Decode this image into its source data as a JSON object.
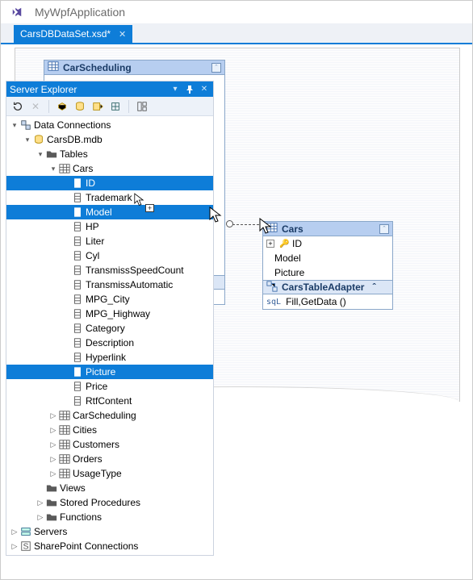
{
  "app": {
    "title": "MyWpfApplication"
  },
  "file_tab": {
    "label": "CarsDBDataSet.xsd*"
  },
  "panel": {
    "title": "Server Explorer",
    "toolbar": {
      "refresh": "↻",
      "stop": "✕"
    }
  },
  "tree": {
    "data_connections": "Data Connections",
    "db": "CarsDB.mdb",
    "tables": "Tables",
    "cars": "Cars",
    "columns": {
      "id": "ID",
      "trademark": "Trademark",
      "model": "Model",
      "hp": "HP",
      "liter": "Liter",
      "cyl": "Cyl",
      "tsc": "TransmissSpeedCount",
      "ta": "TransmissAutomatic",
      "mpgc": "MPG_City",
      "mpgh": "MPG_Highway",
      "category": "Category",
      "desc": "Description",
      "hyper": "Hyperlink",
      "picture": "Picture",
      "price": "Price",
      "rtf": "RtfContent"
    },
    "other_tables": {
      "carscheduling": "CarScheduling",
      "cities": "Cities",
      "customers": "Customers",
      "orders": "Orders",
      "usagetype": "UsageType"
    },
    "views": "Views",
    "sprocs": "Stored Procedures",
    "funcs": "Functions",
    "servers": "Servers",
    "sharepoint": "SharePoint Connections"
  },
  "designer": {
    "carscheduling_box": {
      "title": "CarScheduling"
    },
    "cars_box": {
      "title": "Cars",
      "rows": {
        "id": "ID",
        "model": "Model",
        "picture": "Picture"
      },
      "adapter_title": "CarsTableAdapter",
      "adapter_method": "Fill,GetData ()"
    }
  }
}
